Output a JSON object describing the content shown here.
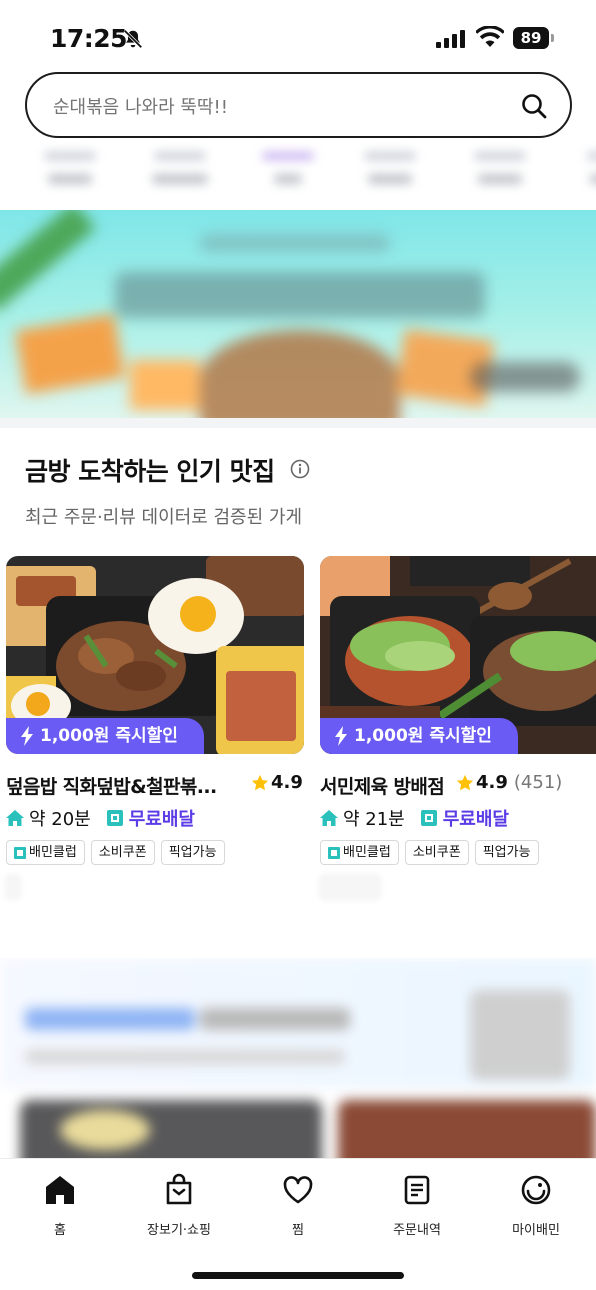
{
  "status": {
    "time": "17:25",
    "battery": "89",
    "icons": [
      "bell-off-icon",
      "signal-icon",
      "wifi-icon",
      "battery-icon"
    ]
  },
  "search": {
    "placeholder": "순대볶음 나와라 뚝딱!!",
    "icon": "search-icon"
  },
  "section": {
    "title": "금방 도착하는 인기 맛집",
    "subtitle": "최근 주문·리뷰 데이터로 검증된 가게"
  },
  "restaurants": [
    {
      "name": "덮음밥 직화덮밥&철판볶...",
      "rating": "4.9",
      "review_count": "",
      "discount": "1,000원 즉시할인",
      "eta": "약 20분",
      "delivery": "무료배달",
      "tags": [
        "배민클럽",
        "소비쿠폰",
        "픽업가능"
      ]
    },
    {
      "name": "서민제육 방배점",
      "rating": "4.9",
      "review_count": "(451)",
      "discount": "1,000원 즉시할인",
      "eta": "약 21분",
      "delivery": "무료배달",
      "tags": [
        "배민클럽",
        "소비쿠폰",
        "픽업가능"
      ]
    }
  ],
  "tabbar": {
    "items": [
      {
        "label": "홈",
        "icon": "home-icon",
        "active": true
      },
      {
        "label": "장보기·쇼핑",
        "icon": "shopping-bag-icon",
        "active": false
      },
      {
        "label": "찜",
        "icon": "heart-icon",
        "active": false
      },
      {
        "label": "주문내역",
        "icon": "receipt-icon",
        "active": false
      },
      {
        "label": "마이배민",
        "icon": "smile-icon",
        "active": false
      }
    ]
  },
  "colors": {
    "accent": "#6a5bf4",
    "free_delivery": "#5b3ce6",
    "club": "#2ac1bc",
    "star": "#ffc107"
  }
}
